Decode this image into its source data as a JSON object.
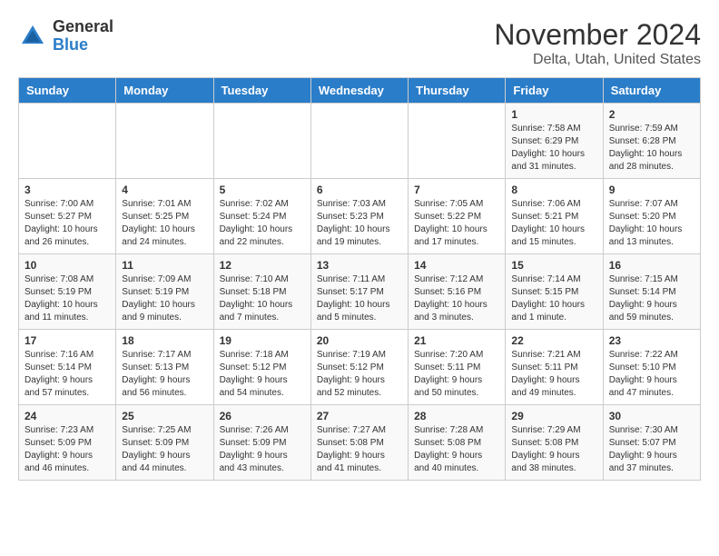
{
  "header": {
    "logo_line1": "General",
    "logo_line2": "Blue",
    "title": "November 2024",
    "subtitle": "Delta, Utah, United States"
  },
  "weekdays": [
    "Sunday",
    "Monday",
    "Tuesday",
    "Wednesday",
    "Thursday",
    "Friday",
    "Saturday"
  ],
  "weeks": [
    [
      {
        "day": "",
        "info": ""
      },
      {
        "day": "",
        "info": ""
      },
      {
        "day": "",
        "info": ""
      },
      {
        "day": "",
        "info": ""
      },
      {
        "day": "",
        "info": ""
      },
      {
        "day": "1",
        "info": "Sunrise: 7:58 AM\nSunset: 6:29 PM\nDaylight: 10 hours and 31 minutes."
      },
      {
        "day": "2",
        "info": "Sunrise: 7:59 AM\nSunset: 6:28 PM\nDaylight: 10 hours and 28 minutes."
      }
    ],
    [
      {
        "day": "3",
        "info": "Sunrise: 7:00 AM\nSunset: 5:27 PM\nDaylight: 10 hours and 26 minutes."
      },
      {
        "day": "4",
        "info": "Sunrise: 7:01 AM\nSunset: 5:25 PM\nDaylight: 10 hours and 24 minutes."
      },
      {
        "day": "5",
        "info": "Sunrise: 7:02 AM\nSunset: 5:24 PM\nDaylight: 10 hours and 22 minutes."
      },
      {
        "day": "6",
        "info": "Sunrise: 7:03 AM\nSunset: 5:23 PM\nDaylight: 10 hours and 19 minutes."
      },
      {
        "day": "7",
        "info": "Sunrise: 7:05 AM\nSunset: 5:22 PM\nDaylight: 10 hours and 17 minutes."
      },
      {
        "day": "8",
        "info": "Sunrise: 7:06 AM\nSunset: 5:21 PM\nDaylight: 10 hours and 15 minutes."
      },
      {
        "day": "9",
        "info": "Sunrise: 7:07 AM\nSunset: 5:20 PM\nDaylight: 10 hours and 13 minutes."
      }
    ],
    [
      {
        "day": "10",
        "info": "Sunrise: 7:08 AM\nSunset: 5:19 PM\nDaylight: 10 hours and 11 minutes."
      },
      {
        "day": "11",
        "info": "Sunrise: 7:09 AM\nSunset: 5:19 PM\nDaylight: 10 hours and 9 minutes."
      },
      {
        "day": "12",
        "info": "Sunrise: 7:10 AM\nSunset: 5:18 PM\nDaylight: 10 hours and 7 minutes."
      },
      {
        "day": "13",
        "info": "Sunrise: 7:11 AM\nSunset: 5:17 PM\nDaylight: 10 hours and 5 minutes."
      },
      {
        "day": "14",
        "info": "Sunrise: 7:12 AM\nSunset: 5:16 PM\nDaylight: 10 hours and 3 minutes."
      },
      {
        "day": "15",
        "info": "Sunrise: 7:14 AM\nSunset: 5:15 PM\nDaylight: 10 hours and 1 minute."
      },
      {
        "day": "16",
        "info": "Sunrise: 7:15 AM\nSunset: 5:14 PM\nDaylight: 9 hours and 59 minutes."
      }
    ],
    [
      {
        "day": "17",
        "info": "Sunrise: 7:16 AM\nSunset: 5:14 PM\nDaylight: 9 hours and 57 minutes."
      },
      {
        "day": "18",
        "info": "Sunrise: 7:17 AM\nSunset: 5:13 PM\nDaylight: 9 hours and 56 minutes."
      },
      {
        "day": "19",
        "info": "Sunrise: 7:18 AM\nSunset: 5:12 PM\nDaylight: 9 hours and 54 minutes."
      },
      {
        "day": "20",
        "info": "Sunrise: 7:19 AM\nSunset: 5:12 PM\nDaylight: 9 hours and 52 minutes."
      },
      {
        "day": "21",
        "info": "Sunrise: 7:20 AM\nSunset: 5:11 PM\nDaylight: 9 hours and 50 minutes."
      },
      {
        "day": "22",
        "info": "Sunrise: 7:21 AM\nSunset: 5:11 PM\nDaylight: 9 hours and 49 minutes."
      },
      {
        "day": "23",
        "info": "Sunrise: 7:22 AM\nSunset: 5:10 PM\nDaylight: 9 hours and 47 minutes."
      }
    ],
    [
      {
        "day": "24",
        "info": "Sunrise: 7:23 AM\nSunset: 5:09 PM\nDaylight: 9 hours and 46 minutes."
      },
      {
        "day": "25",
        "info": "Sunrise: 7:25 AM\nSunset: 5:09 PM\nDaylight: 9 hours and 44 minutes."
      },
      {
        "day": "26",
        "info": "Sunrise: 7:26 AM\nSunset: 5:09 PM\nDaylight: 9 hours and 43 minutes."
      },
      {
        "day": "27",
        "info": "Sunrise: 7:27 AM\nSunset: 5:08 PM\nDaylight: 9 hours and 41 minutes."
      },
      {
        "day": "28",
        "info": "Sunrise: 7:28 AM\nSunset: 5:08 PM\nDaylight: 9 hours and 40 minutes."
      },
      {
        "day": "29",
        "info": "Sunrise: 7:29 AM\nSunset: 5:08 PM\nDaylight: 9 hours and 38 minutes."
      },
      {
        "day": "30",
        "info": "Sunrise: 7:30 AM\nSunset: 5:07 PM\nDaylight: 9 hours and 37 minutes."
      }
    ]
  ]
}
